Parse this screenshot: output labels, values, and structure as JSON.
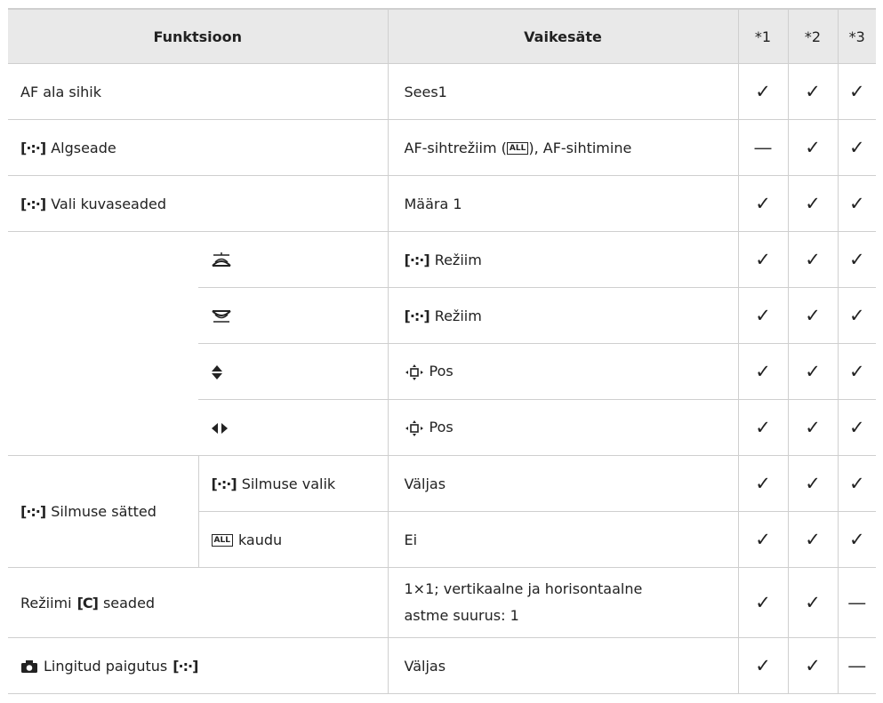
{
  "headers": {
    "function": "Funktsioon",
    "default": "Vaikesäte",
    "m1": "*1",
    "m2": "*2",
    "m3": "*3"
  },
  "rows": [
    {
      "label": "AF ala sihik",
      "value": "Sees1",
      "m1": "✓",
      "m2": "✓",
      "m3": "✓"
    },
    {
      "label": "Algseade",
      "value_pre": "AF-sihtrežiim (",
      "value_post": "), AF-sihtimine",
      "m1": "—",
      "m2": "✓",
      "m3": "✓"
    },
    {
      "label": "Vali kuvaseaded",
      "value": "Määra 1",
      "m1": "✓",
      "m2": "✓",
      "m3": "✓"
    },
    {
      "value": "Režiim",
      "m1": "✓",
      "m2": "✓",
      "m3": "✓"
    },
    {
      "value": "Režiim",
      "m1": "✓",
      "m2": "✓",
      "m3": "✓"
    },
    {
      "value": "Pos",
      "m1": "✓",
      "m2": "✓",
      "m3": "✓"
    },
    {
      "value": "Pos",
      "m1": "✓",
      "m2": "✓",
      "m3": "✓"
    },
    {
      "group": "Silmuse sätted",
      "label": "Silmuse valik",
      "value": "Väljas",
      "m1": "✓",
      "m2": "✓",
      "m3": "✓"
    },
    {
      "label": "kaudu",
      "value": "Ei",
      "m1": "✓",
      "m2": "✓",
      "m3": "✓"
    },
    {
      "label_pre": "Režiimi",
      "label_post": "seaded",
      "value_line1": "1×1; vertikaalne ja horisontaalne",
      "value_line2": "astme suurus: 1",
      "m1": "✓",
      "m2": "✓",
      "m3": "—"
    },
    {
      "label": "Lingitud paigutus",
      "value": "Väljas",
      "m1": "✓",
      "m2": "✓",
      "m3": "—"
    }
  ],
  "icons": {
    "af_target": "[·:·]",
    "all_target": "ALL",
    "cfg_c": "C",
    "front_dial": "front-dial-icon",
    "rear_dial": "rear-dial-icon",
    "updown": "up-down-arrow-icon",
    "leftright": "left-right-arrow-icon",
    "pos_cross": "position-cross-icon",
    "camera": "camera-icon"
  }
}
